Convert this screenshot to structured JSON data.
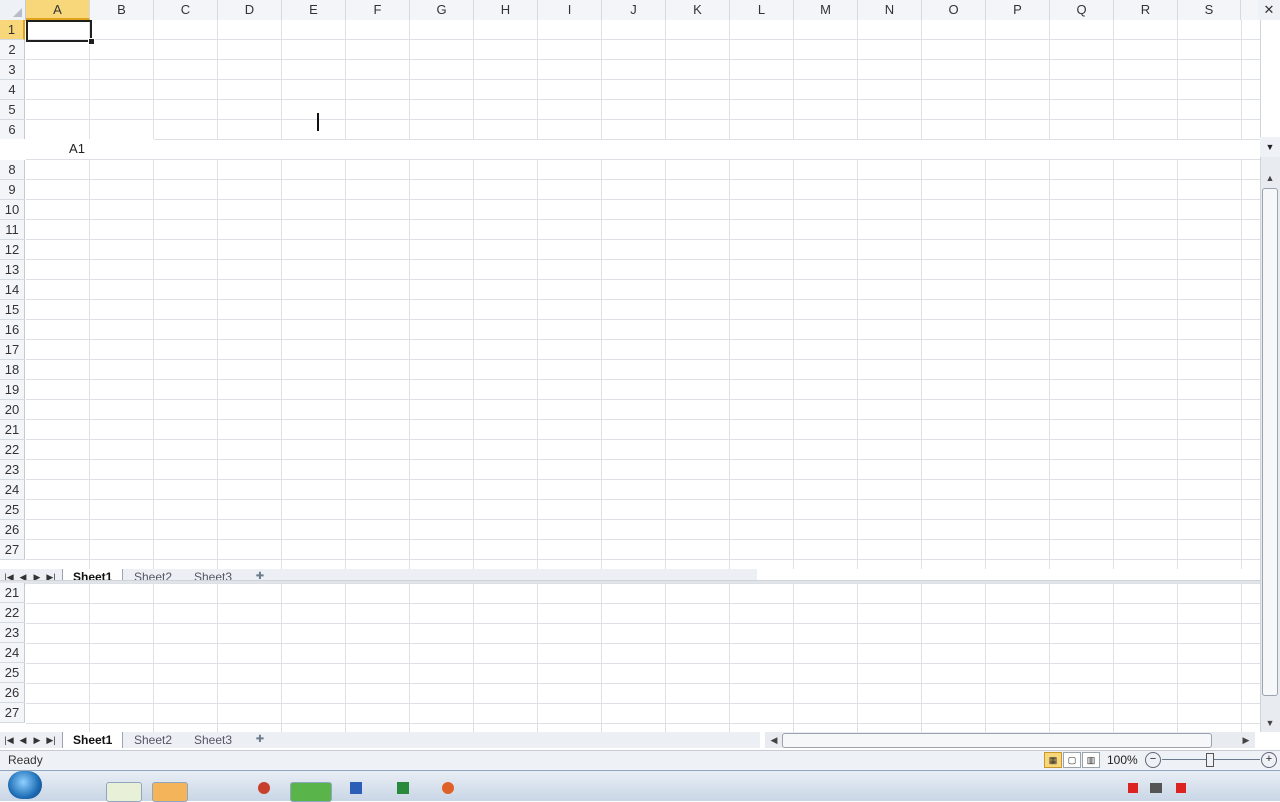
{
  "columns": [
    "A",
    "B",
    "C",
    "D",
    "E",
    "F",
    "G",
    "H",
    "I",
    "J",
    "K",
    "L",
    "M",
    "N",
    "O",
    "P",
    "Q",
    "R",
    "S"
  ],
  "rows_top": [
    "1",
    "2",
    "3",
    "4",
    "5",
    "6"
  ],
  "rows_mid": [
    "8",
    "9",
    "10",
    "11",
    "12",
    "13",
    "14",
    "15",
    "16",
    "17",
    "18",
    "19",
    "20",
    "21",
    "22",
    "23",
    "24",
    "25",
    "26",
    "27"
  ],
  "rows_bottom": [
    "21",
    "22",
    "23",
    "24",
    "25",
    "26",
    "27"
  ],
  "name_box": "A1",
  "sheet_tabs": [
    "Sheet1",
    "Sheet2",
    "Sheet3"
  ],
  "active_sheet": "Sheet1",
  "status": "Ready",
  "zoom": "100%",
  "zoom_minus": "−",
  "zoom_plus": "+",
  "icons": {
    "first_sheet": "first-sheet-icon",
    "prev_sheet": "prev-sheet-icon",
    "next_sheet": "next-sheet-icon",
    "last_sheet": "last-sheet-icon",
    "insert_sheet": "insert-sheet-icon"
  },
  "colors": {
    "selection_header": "#f8d77a",
    "selection_accent": "#e0a31a",
    "gridline": "#dde1e6"
  }
}
